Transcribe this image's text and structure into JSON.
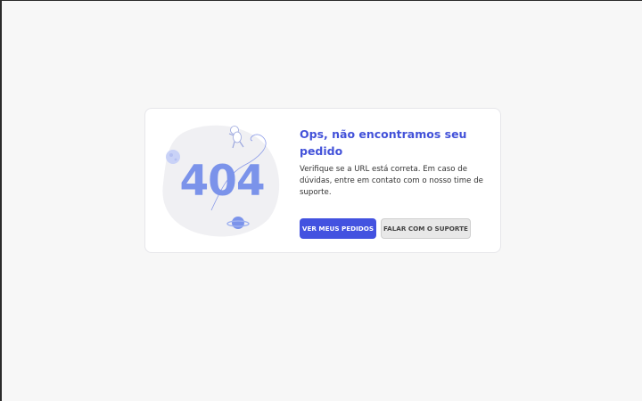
{
  "error": {
    "code": "404",
    "title": "Ops, não encontramos seu pedido",
    "description": "Verifique se a URL está correta. Em caso de dúvidas, entre em contato com o nosso time de suporte."
  },
  "actions": {
    "primary_label": "VER MEUS PEDIDOS",
    "secondary_label": "FALAR COM O SUPORTE"
  },
  "illustration": {
    "icons": [
      "astronaut-icon",
      "planet-icon",
      "moon-icon"
    ]
  },
  "colors": {
    "accent": "#4352e0",
    "title": "#4352d9",
    "code": "#7b93ea",
    "blob": "#f0f0f3",
    "page_bg": "#f7f7f7"
  }
}
